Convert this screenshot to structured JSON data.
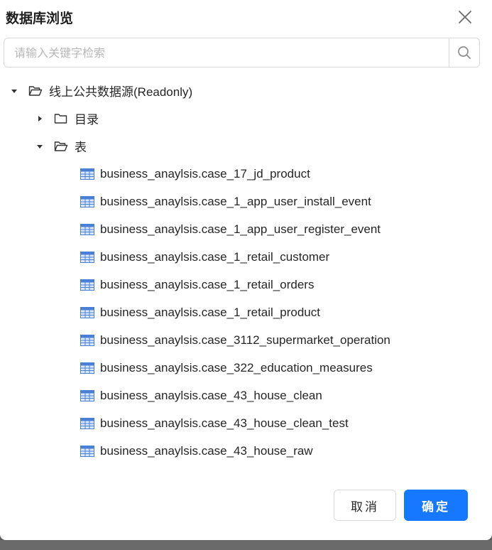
{
  "dialog": {
    "title": "数据库浏览",
    "close_icon": "close-icon"
  },
  "search": {
    "placeholder": "请输入关键字检索",
    "value": "",
    "icon": "search-icon"
  },
  "tree": {
    "root": {
      "label": "线上公共数据源(Readonly)",
      "expanded": true,
      "children": [
        {
          "label": "目录",
          "expanded": false
        },
        {
          "label": "表",
          "expanded": true,
          "tables": [
            "business_anaylsis.case_17_jd_product",
            "business_anaylsis.case_1_app_user_install_event",
            "business_anaylsis.case_1_app_user_register_event",
            "business_anaylsis.case_1_retail_customer",
            "business_anaylsis.case_1_retail_orders",
            "business_anaylsis.case_1_retail_product",
            "business_anaylsis.case_3112_supermarket_operation",
            "business_anaylsis.case_322_education_measures",
            "business_anaylsis.case_43_house_clean",
            "business_anaylsis.case_43_house_clean_test",
            "business_anaylsis.case_43_house_raw"
          ]
        }
      ]
    }
  },
  "footer": {
    "cancel_label": "取消",
    "ok_label": "确定"
  },
  "colors": {
    "primary": "#1677ff",
    "table_icon": "#4a7fd8",
    "border": "#d9d9d9"
  }
}
